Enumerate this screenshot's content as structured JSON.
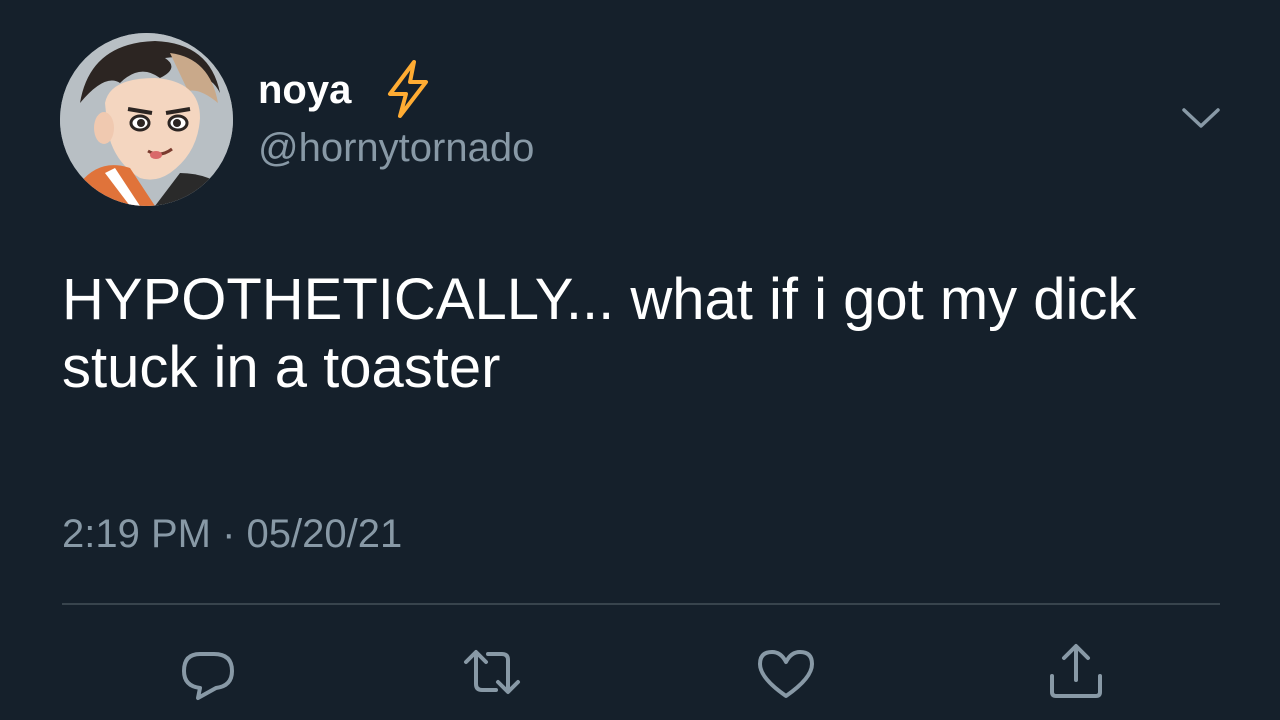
{
  "colors": {
    "background": "#15202b",
    "primary_text": "#ffffff",
    "secondary_text": "#8899a6",
    "divider": "#38444d",
    "bolt": "#ffac33"
  },
  "user": {
    "display_name": "noya",
    "name_emoji": "lightning-bolt-emoji",
    "handle": "@hornytornado",
    "avatar": "anime-character-avatar"
  },
  "tweet": {
    "text": "HYPOTHETICALLY... what if i got my dick stuck in a toaster",
    "timestamp": "2:19 PM · 05/20/21"
  },
  "actions": {
    "menu": "chevron-down-icon",
    "reply": "reply-icon",
    "retweet": "retweet-icon",
    "like": "heart-icon",
    "share": "share-icon"
  }
}
